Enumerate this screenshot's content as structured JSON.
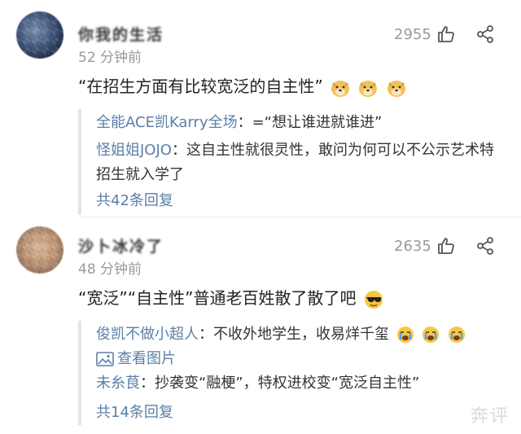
{
  "comments": [
    {
      "username": "你我的生活",
      "time": "52 分钟前",
      "likes": "2955",
      "text": "“在招生方面有比较宽泛的自主性”",
      "replies": [
        {
          "name": "全能ACE凯Karry全场",
          "sep": "：",
          "text": "=“想让谁进就谁进”"
        },
        {
          "name": "怪姐姐JOJO",
          "sep": "：",
          "text": "这自主性就很灵性，敢问为何可以不公示艺术特招生就入学了"
        }
      ],
      "more": "共42条回复"
    },
    {
      "username": "沙卜冰冷了",
      "time": "48 分钟前",
      "likes": "2635",
      "text": "“宽泛”“自主性”普通老百姓散了散了吧",
      "replies": [
        {
          "name": "俊凯不做小超人",
          "sep": "：",
          "text": "不收外地学生，收易烊千玺"
        },
        {
          "name": "",
          "sep": "",
          "text": "查看图片"
        },
        {
          "name": "未糸茛",
          "sep": "：",
          "text": "抄袭变“融梗”，特权进校变“宽泛自主性”"
        }
      ],
      "more": "共14条回复"
    }
  ],
  "watermark": "奔评",
  "icons": {
    "like": "thumbs-up-icon",
    "share": "share-icon",
    "image": "image-icon",
    "emoji_doge": "doge-emoji-icon",
    "emoji_cool": "sunglasses-emoji-icon",
    "emoji_cry": "crying-emoji-icon"
  },
  "colors": {
    "link": "#5b7fa8",
    "meta": "#999999"
  }
}
